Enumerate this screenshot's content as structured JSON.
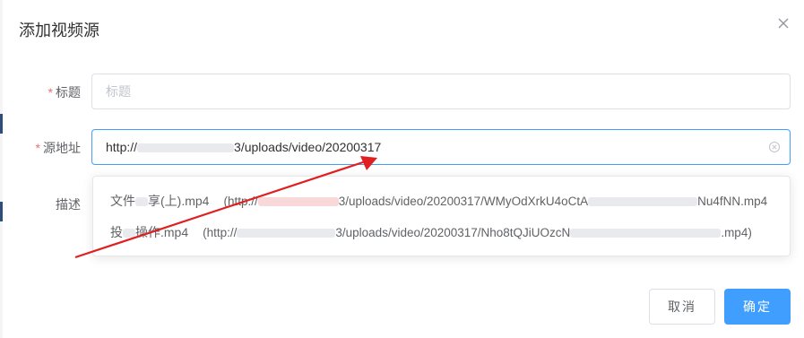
{
  "dialog": {
    "title": "添加视频源"
  },
  "form": {
    "title_field": {
      "label": "标题",
      "required_mark": "*",
      "placeholder": "标题"
    },
    "source_field": {
      "label": "源地址",
      "required_mark": "*",
      "value_prefix": "http://",
      "value_suffix": "3/uploads/video/20200317"
    },
    "desc_field": {
      "label": "描述"
    }
  },
  "suggestions": [
    {
      "name_a": "文件",
      "name_b": "享(上).mp4",
      "url_a": "(http://",
      "url_b": "3/uploads/video/20200317/WMyOdXrkU4oCtA",
      "url_c": "Nu4fNN.mp4"
    },
    {
      "name_a": "投",
      "name_b": "操作.mp4",
      "url_a": "(http://",
      "url_b": "3/uploads/video/20200317/Nho8tQJiUOzcN",
      "url_c": ".mp4)"
    }
  ],
  "footer": {
    "cancel_label": "取消",
    "ok_label": "确定"
  },
  "colors": {
    "primary": "#409eff",
    "required": "#f56c6c",
    "annotation_arrow": "#e02020",
    "sidebar_edge": "#2b4f7a"
  },
  "icons": {
    "close": "close-icon",
    "clear": "circle-close-icon"
  }
}
